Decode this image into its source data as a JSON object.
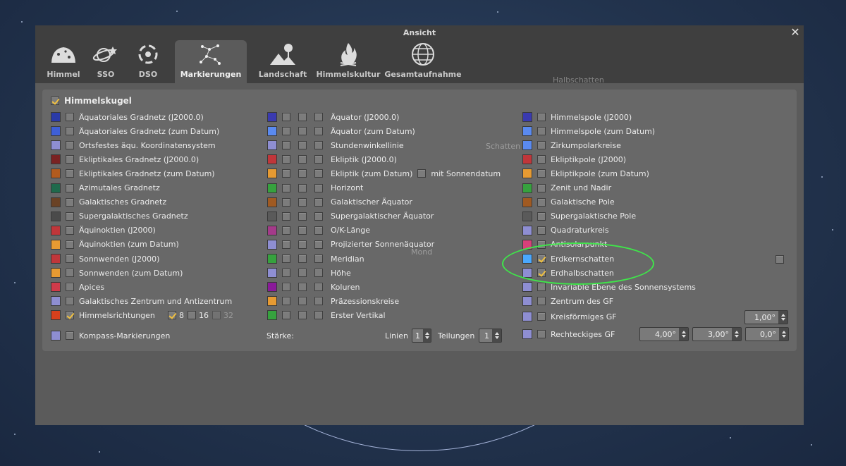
{
  "window": {
    "title": "Ansicht",
    "close_glyph": "✕"
  },
  "tabs": [
    {
      "label": "Himmel",
      "icon": "sky-icon"
    },
    {
      "label": "SSO",
      "icon": "planet-icon"
    },
    {
      "label": "DSO",
      "icon": "galaxy-icon"
    },
    {
      "label": "Markierungen",
      "icon": "constellation-icon",
      "active": true
    },
    {
      "label": "Landschaft",
      "icon": "landscape-icon"
    },
    {
      "label": "Himmelskultur",
      "icon": "fire-icon"
    },
    {
      "label": "Gesamtaufnahme",
      "icon": "sphere-icon"
    }
  ],
  "group": {
    "label": "Himmelskugel",
    "checked": true
  },
  "col1": [
    {
      "label": "Äquatoriales Gradnetz (J2000.0)",
      "color": "#2a3aa8"
    },
    {
      "label": "Äquatoriales Gradnetz (zum Datum)",
      "color": "#3e5fd6"
    },
    {
      "label": "Ortsfestes äqu. Koordinatensystem",
      "color": "#8e8ed2"
    },
    {
      "label": "Ekliptikales Gradnetz (J2000.0)",
      "color": "#7a2222"
    },
    {
      "label": "Ekliptikales Gradnetz (zum Datum)",
      "color": "#b25b1e"
    },
    {
      "label": "Azimutales Gradnetz",
      "color": "#1f6a4c"
    },
    {
      "label": "Galaktisches Gradnetz",
      "color": "#6a4225"
    },
    {
      "label": "Supergalaktisches Gradnetz",
      "color": "#4a4a4a"
    },
    {
      "label": "Äquinoktien (J2000)",
      "color": "#c0363a"
    },
    {
      "label": "Äquinoktien (zum Datum)",
      "color": "#e69a32"
    },
    {
      "label": "Sonnwenden (J2000)",
      "color": "#c0363a"
    },
    {
      "label": "Sonnwenden (zum Datum)",
      "color": "#e69a32"
    },
    {
      "label": "Apices",
      "color": "#d03a4a"
    },
    {
      "label": "Galaktisches Zentrum und Antizentrum",
      "color": "#8e8ed2"
    },
    {
      "label": "Himmelsrichtungen",
      "color": "#d8401c",
      "checked": true
    }
  ],
  "cardinal": {
    "opt8": "8",
    "opt16": "16",
    "opt32": "32"
  },
  "compass": {
    "label": "Kompass-Markierungen",
    "color": "#8e8ed2"
  },
  "col2": [
    {
      "label": "Äquator (J2000.0)",
      "color": "#3a3ab0"
    },
    {
      "label": "Äquator (zum Datum)",
      "color": "#5a8af0"
    },
    {
      "label": "Stundenwinkellinie",
      "color": "#8e8ed2"
    },
    {
      "label": "Ekliptik (J2000.0)",
      "color": "#c0363a"
    },
    {
      "label": "Ekliptik (zum Datum)",
      "color": "#e69a32",
      "extra": "mit Sonnendatum"
    },
    {
      "label": "Horizont",
      "color": "#36a23e"
    },
    {
      "label": "Galaktischer Äquator",
      "color": "#a05a22"
    },
    {
      "label": "Supergalaktischer Äquator",
      "color": "#5a5a5a"
    },
    {
      "label": "O/K-Länge",
      "color": "#a43a8a"
    },
    {
      "label": "Projizierter Sonnenäquator",
      "color": "#8e8ed2"
    },
    {
      "label": "Meridian",
      "color": "#36a23e"
    },
    {
      "label": "Höhe",
      "color": "#8e8ed2"
    },
    {
      "label": "Koluren",
      "color": "#8a1a9a"
    },
    {
      "label": "Präzessionskreise",
      "color": "#e69a32"
    },
    {
      "label": "Erster Vertikal",
      "color": "#36a23e"
    }
  ],
  "thickness": {
    "label": "Stärke:",
    "lines_label": "Linien",
    "lines_value": "1",
    "divisions_label": "Teilungen",
    "divisions_value": "1"
  },
  "col3": [
    {
      "label": "Himmelspole (J2000)",
      "color": "#3a3ab0"
    },
    {
      "label": "Himmelspole (zum Datum)",
      "color": "#5a8af0"
    },
    {
      "label": "Zirkumpolarkreise",
      "color": "#5a8af0"
    },
    {
      "label": "Ekliptikpole (J2000)",
      "color": "#c0363a"
    },
    {
      "label": "Ekliptikpole (zum Datum)",
      "color": "#e69a32"
    },
    {
      "label": "Zenit und Nadir",
      "color": "#36a23e"
    },
    {
      "label": "Galaktische Pole",
      "color": "#a05a22"
    },
    {
      "label": "Supergalaktische Pole",
      "color": "#5a5a5a"
    },
    {
      "label": "Quadraturkreis",
      "color": "#8e8ed2"
    },
    {
      "label": "Antisolarpunkt",
      "color": "#d8407a"
    },
    {
      "label": "Erdkernschatten",
      "color": "#4aa8ff",
      "checked": true
    },
    {
      "label": "Erdhalbschatten",
      "color": "#8e8ed2",
      "checked": true
    },
    {
      "label": "Invariable Ebene des Sonnensystems",
      "color": "#8e8ed2"
    },
    {
      "label": "Zentrum des GF",
      "color": "#8e8ed2"
    },
    {
      "label": "Kreisförmiges GF",
      "color": "#8e8ed2"
    },
    {
      "label": "Rechteckiges GF",
      "color": "#8e8ed2"
    }
  ],
  "fov": {
    "circle_value": "1,00°",
    "rect_w": "4,00°",
    "rect_h": "3,00°",
    "rect_rot": "0,0°"
  },
  "sky_labels": {
    "halbschatten": "Halbschatten",
    "schatten": "Schatten",
    "mond": "Mond"
  }
}
